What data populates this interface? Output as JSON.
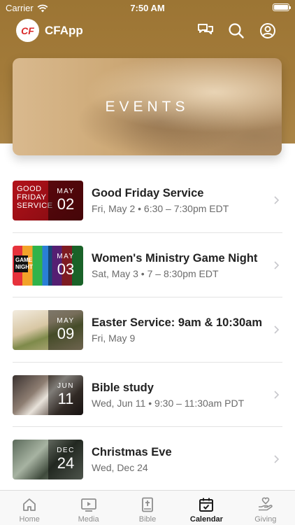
{
  "status_bar": {
    "carrier": "Carrier",
    "time": "7:50 AM",
    "battery_level": 1.0
  },
  "app": {
    "logo_text": "CF",
    "title": "CFApp"
  },
  "banner": {
    "title": "EVENTS"
  },
  "events": [
    {
      "title": "Good Friday Service",
      "time": "Fri, May 2 • 6:30 – 7:30pm EDT",
      "month": "MAY",
      "day": "02"
    },
    {
      "title": "Women's Ministry Game Night",
      "time": "Sat, May 3 • 7 – 8:30pm EDT",
      "month": "MAY",
      "day": "03"
    },
    {
      "title": "Easter Service: 9am & 10:30am",
      "time": "Fri, May 9",
      "month": "MAY",
      "day": "09"
    },
    {
      "title": "Bible study",
      "time": "Wed, Jun 11 • 9:30 – 11:30am PDT",
      "month": "JUN",
      "day": "11"
    },
    {
      "title": "Christmas Eve",
      "time": "Wed, Dec 24",
      "month": "DEC",
      "day": "24"
    }
  ],
  "thumb_texts": {
    "good_friday": "GOOD FRIDAY SERVICE",
    "game_night": "GAME NIGHT"
  },
  "tabs": [
    {
      "label": "Home",
      "icon": "home-icon"
    },
    {
      "label": "Media",
      "icon": "media-icon"
    },
    {
      "label": "Bible",
      "icon": "bible-icon"
    },
    {
      "label": "Calendar",
      "icon": "calendar-icon",
      "active": true
    },
    {
      "label": "Giving",
      "icon": "giving-icon"
    }
  ],
  "colors": {
    "header": "#a37b3a",
    "active_tab": "#1a1a1a",
    "inactive_tab": "#8e8e8e"
  }
}
